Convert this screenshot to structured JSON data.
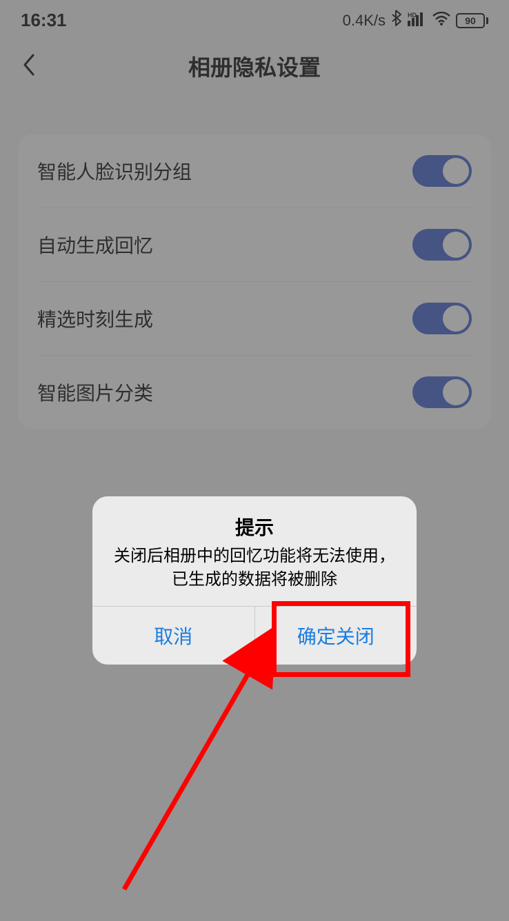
{
  "status_bar": {
    "time": "16:31",
    "speed": "0.4K/s",
    "battery": "90"
  },
  "header": {
    "title": "相册隐私设置"
  },
  "settings": [
    {
      "label": "智能人脸识别分组",
      "on": true
    },
    {
      "label": "自动生成回忆",
      "on": true
    },
    {
      "label": "精选时刻生成",
      "on": true
    },
    {
      "label": "智能图片分类",
      "on": true
    }
  ],
  "dialog": {
    "title": "提示",
    "message": "关闭后相册中的回忆功能将无法使用，已生成的数据将被删除",
    "cancel": "取消",
    "confirm": "确定关闭"
  }
}
